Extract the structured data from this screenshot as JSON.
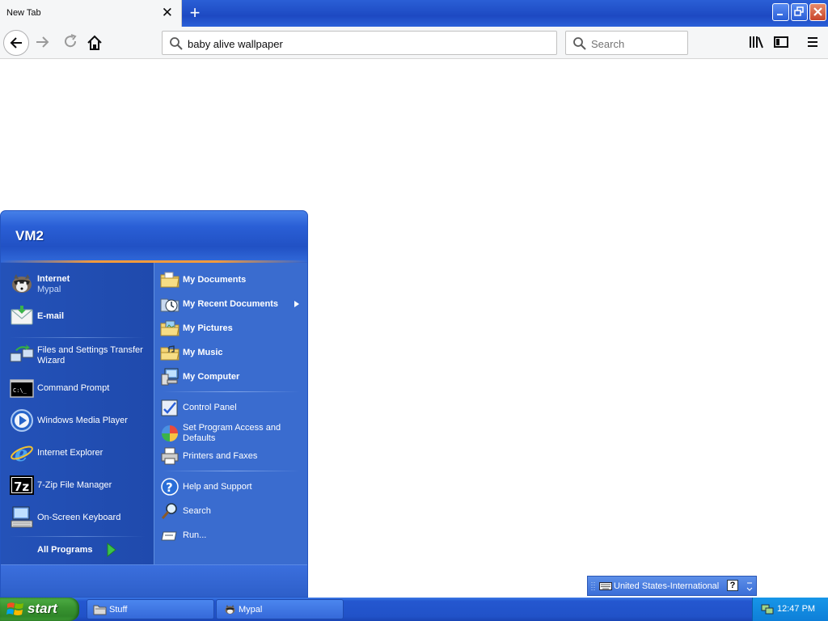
{
  "browser": {
    "tab_title": "New Tab",
    "tab_close": "✕",
    "new_tab": "+",
    "url": "baby alive wallpaper",
    "search_placeholder": "Search"
  },
  "start_menu": {
    "user": "VM2",
    "pinned": [
      {
        "title": "Internet",
        "subtitle": "Mypal",
        "icon": "mypal-raccoon-icon"
      },
      {
        "title": "E-mail",
        "icon": "email-envelope-icon"
      }
    ],
    "recent": [
      {
        "label": "Files and Settings Transfer Wizard",
        "icon": "transfer-wizard-icon"
      },
      {
        "label": "Command Prompt",
        "icon": "cmd-icon"
      },
      {
        "label": "Windows Media Player",
        "icon": "media-player-icon"
      },
      {
        "label": "Internet Explorer",
        "icon": "ie-icon"
      },
      {
        "label": "7-Zip File Manager",
        "icon": "7zip-icon"
      },
      {
        "label": "On-Screen Keyboard",
        "icon": "osk-icon"
      }
    ],
    "all_programs": "All Programs",
    "right_items": [
      {
        "label": "My Documents",
        "icon": "documents-folder-icon"
      },
      {
        "label": "My Recent Documents",
        "icon": "recent-documents-icon"
      },
      {
        "label": "My Pictures",
        "icon": "pictures-folder-icon"
      },
      {
        "label": "My Music",
        "icon": "music-folder-icon"
      },
      {
        "label": "My Computer",
        "icon": "computer-icon"
      },
      {
        "label": "Control Panel",
        "icon": "control-panel-icon"
      },
      {
        "label": "Set Program Access and Defaults",
        "icon": "program-access-icon"
      },
      {
        "label": "Printers and Faxes",
        "icon": "printer-icon"
      },
      {
        "label": "Help and Support",
        "icon": "help-icon"
      },
      {
        "label": "Search",
        "icon": "search-icon"
      },
      {
        "label": "Run...",
        "icon": "run-icon"
      }
    ]
  },
  "language_bar": {
    "label": "United States-International",
    "help": "?"
  },
  "taskbar": {
    "start": "start",
    "buttons": [
      {
        "label": "Stuff",
        "icon": "folder-icon"
      },
      {
        "label": "Mypal",
        "icon": "mypal-raccoon-icon"
      }
    ],
    "clock": "12:47 PM"
  },
  "colors": {
    "xp_blue": "#2a5fd6",
    "start_green": "#3a9532",
    "tray_blue": "#0e7fd8"
  }
}
